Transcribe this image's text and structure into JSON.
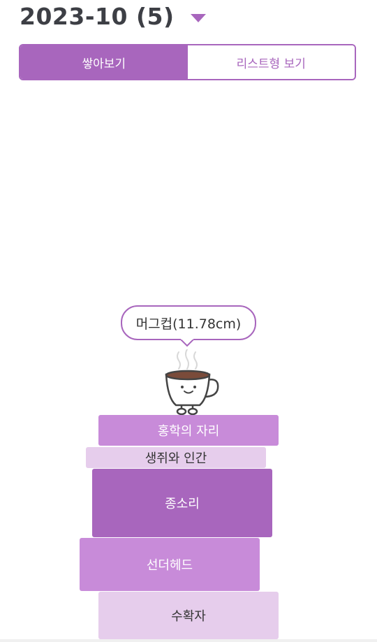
{
  "header": {
    "title": "2023-10 (5)",
    "dropdown_icon": "caret-down-icon"
  },
  "tabs": [
    {
      "label": "쌓아보기",
      "active": true
    },
    {
      "label": "리스트형 보기",
      "active": false
    }
  ],
  "stack": {
    "height_label": "머그컵(11.78cm)",
    "mascot_icon": "coffee-mug-icon",
    "books": [
      {
        "title": "홍학의 자리",
        "tone": "mid"
      },
      {
        "title": "생쥐와 인간",
        "tone": "light"
      },
      {
        "title": "종소리",
        "tone": "dark"
      },
      {
        "title": "선더헤드",
        "tone": "mid"
      },
      {
        "title": "수확자",
        "tone": "light"
      }
    ]
  },
  "colors": {
    "accent": "#a866bd",
    "book_mid": "#c88bd9",
    "book_light": "#e6cdec",
    "title_text": "#3d3f45"
  }
}
